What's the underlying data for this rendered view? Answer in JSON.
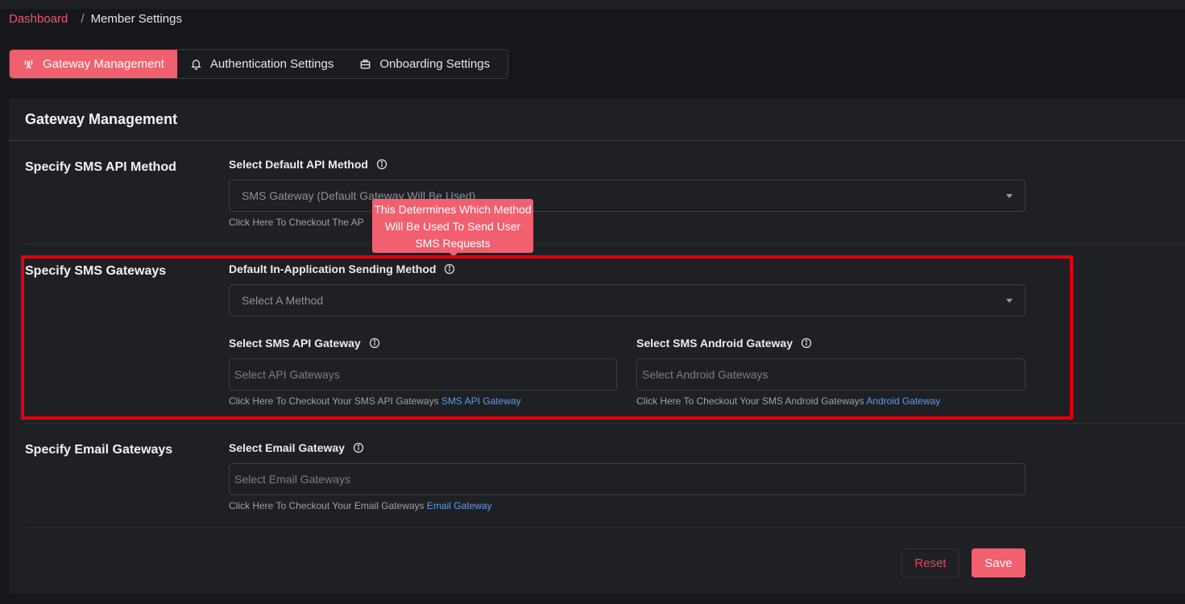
{
  "breadcrumb": {
    "parent": "Dashboard",
    "separator": "/",
    "current": "Member Settings"
  },
  "tabs": [
    {
      "label": "Gateway Management",
      "icon": "broadcast-icon",
      "active": true
    },
    {
      "label": "Authentication Settings",
      "icon": "bell-icon",
      "active": false
    },
    {
      "label": "Onboarding Settings",
      "icon": "briefcase-icon",
      "active": false
    }
  ],
  "card": {
    "title": "Gateway Management"
  },
  "api_method": {
    "section": "Specify SMS API Method",
    "label": "Select Default API Method",
    "value": "SMS Gateway (Default Gateway Will Be Used)",
    "help": "Click Here To Checkout The AP"
  },
  "tooltip": {
    "text": "This Determines Which Method Will Be Used To Send User SMS Requests"
  },
  "sms_gateways": {
    "section": "Specify SMS Gateways",
    "method_label": "Default In-Application Sending Method",
    "method_value": "Select A Method",
    "api_label": "Select SMS API Gateway",
    "api_placeholder": "Select API Gateways",
    "api_help": "Click Here To Checkout Your SMS API Gateways",
    "api_link": "SMS API Gateway",
    "android_label": "Select SMS Android Gateway",
    "android_placeholder": "Select Android Gateways",
    "android_help": "Click Here To Checkout Your SMS Android Gateways",
    "android_link": "Android Gateway"
  },
  "email_gateways": {
    "section": "Specify Email Gateways",
    "label": "Select Email Gateway",
    "placeholder": "Select Email Gateways",
    "help": "Click Here To Checkout Your Email Gateways",
    "link": "Email Gateway"
  },
  "actions": {
    "reset": "Reset",
    "save": "Save"
  },
  "colors": {
    "accent": "#f0606f",
    "link": "#5c9cf0",
    "highlight": "#e5000f"
  }
}
